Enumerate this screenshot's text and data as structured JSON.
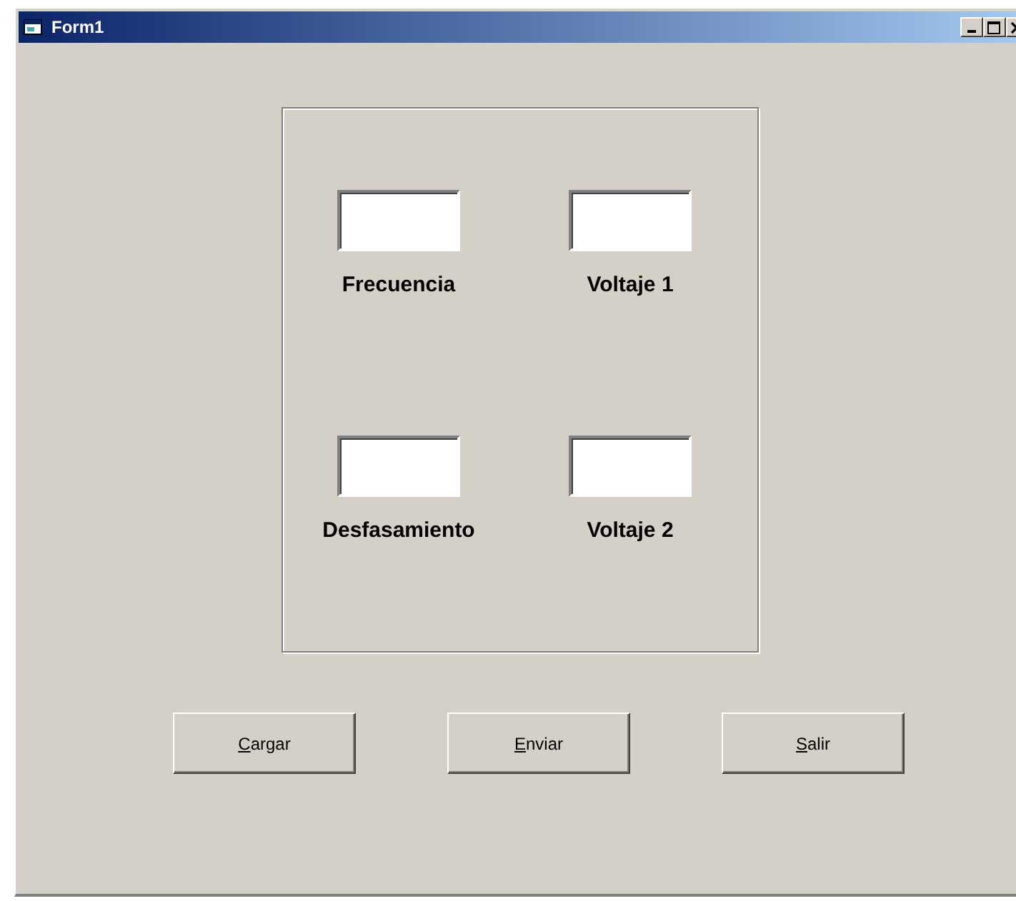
{
  "window": {
    "title": "Form1"
  },
  "fields": [
    {
      "label": "Frecuencia"
    },
    {
      "label": "Voltaje 1"
    },
    {
      "label": "Desfasamiento"
    },
    {
      "label": "Voltaje 2"
    }
  ],
  "buttons": [
    {
      "label": "Cargar",
      "mnemonic_underlined": true
    },
    {
      "label": "Enviar",
      "mnemonic_underlined": true
    },
    {
      "label": "Salir",
      "mnemonic_underlined": true
    }
  ]
}
